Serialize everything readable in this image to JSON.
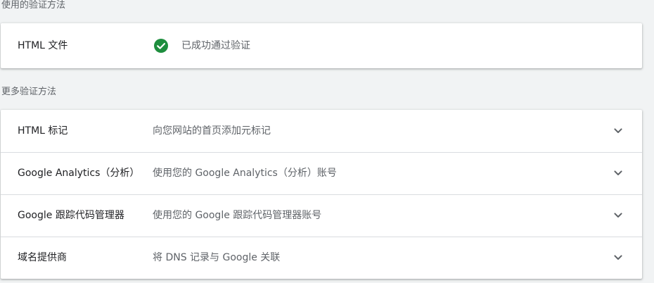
{
  "used_section": {
    "title": "使用的验证方法",
    "method_label": "HTML 文件",
    "status_text": "已成功通过验证",
    "status_icon": "check-circle-icon",
    "status_color": "#1e8e3e"
  },
  "more_section": {
    "title": "更多验证方法",
    "methods": [
      {
        "label": "HTML 标记",
        "description": "向您网站的首页添加元标记",
        "icon": "chevron-down-icon"
      },
      {
        "label": "Google Analytics（分析）",
        "description": "使用您的 Google Analytics（分析）账号",
        "icon": "chevron-down-icon"
      },
      {
        "label": "Google 跟踪代码管理器",
        "description": "使用您的 Google 跟踪代码管理器账号",
        "icon": "chevron-down-icon"
      },
      {
        "label": "域名提供商",
        "description": "将 DNS 记录与 Google 关联",
        "icon": "chevron-down-icon"
      }
    ]
  }
}
